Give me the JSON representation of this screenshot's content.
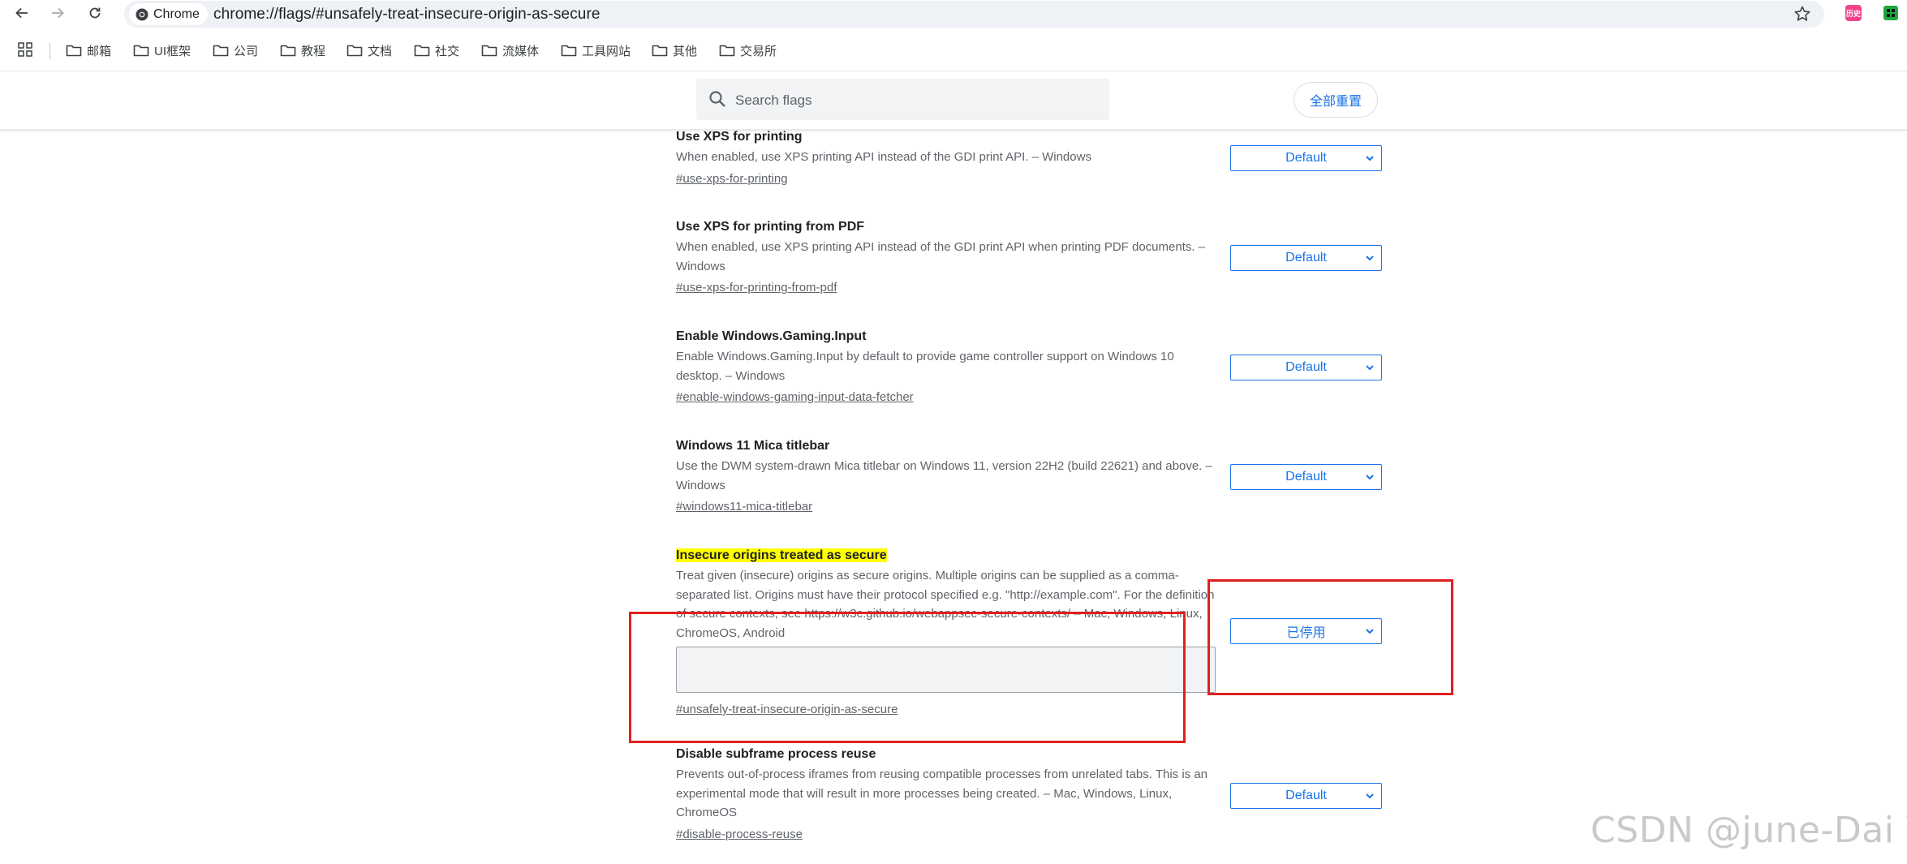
{
  "browser": {
    "site_chip_label": "Chrome",
    "url": "chrome://flags/#unsafely-treat-insecure-origin-as-secure",
    "ext_badge_text": "历史"
  },
  "bookmarks": [
    {
      "label": "邮箱"
    },
    {
      "label": "UI框架"
    },
    {
      "label": "公司"
    },
    {
      "label": "教程"
    },
    {
      "label": "文档"
    },
    {
      "label": "社交"
    },
    {
      "label": "流媒体"
    },
    {
      "label": "工具网站"
    },
    {
      "label": "其他"
    },
    {
      "label": "交易所"
    }
  ],
  "search": {
    "placeholder": "Search flags",
    "value": ""
  },
  "reset_all_label": "全部重置",
  "flags": [
    {
      "title": "Use XPS for printing",
      "description": "When enabled, use XPS printing API instead of the GDI print API. – Windows",
      "link": "#use-xps-for-printing",
      "value": "Default"
    },
    {
      "title": "Use XPS for printing from PDF",
      "description": "When enabled, use XPS printing API instead of the GDI print API when printing PDF documents. – Windows",
      "link": "#use-xps-for-printing-from-pdf",
      "value": "Default"
    },
    {
      "title": "Enable Windows.Gaming.Input",
      "description": "Enable Windows.Gaming.Input by default to provide game controller support on Windows 10 desktop. – Windows",
      "link": "#enable-windows-gaming-input-data-fetcher",
      "value": "Default"
    },
    {
      "title": "Windows 11 Mica titlebar",
      "description": "Use the DWM system-drawn Mica titlebar on Windows 11, version 22H2 (build 22621) and above. – Windows",
      "link": "#windows11-mica-titlebar",
      "value": "Default"
    },
    {
      "title": "Insecure origins treated as secure",
      "description": "Treat given (insecure) origins as secure origins. Multiple origins can be supplied as a comma-separated list. Origins must have their protocol specified e.g. \"http://example.com\". For the definition of secure contexts, see https://w3c.github.io/webappsec-secure-contexts/ – Mac, Windows, Linux, ChromeOS, Android",
      "textarea_value": "",
      "link": "#unsafely-treat-insecure-origin-as-secure",
      "value": "已停用"
    },
    {
      "title": "Disable subframe process reuse",
      "description": "Prevents out-of-process iframes from reusing compatible processes from unrelated tabs. This is an experimental mode that will result in more processes being created. – Mac, Windows, Linux, ChromeOS",
      "link": "#disable-process-reuse",
      "value": "Default"
    }
  ],
  "watermark": "CSDN @june-Dai Yi",
  "colors": {
    "accent": "#1a73e8",
    "highlight": "#ffff00",
    "annotation_red": "#e02020"
  }
}
